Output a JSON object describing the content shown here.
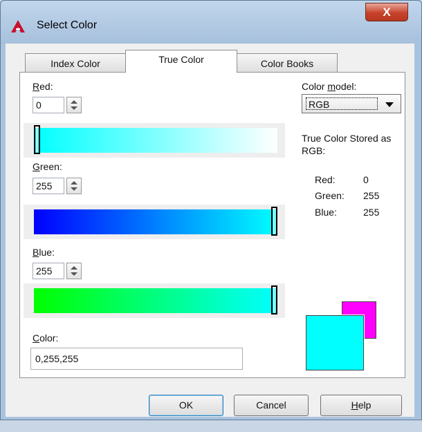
{
  "window": {
    "title": "Select Color",
    "close_glyph": "X"
  },
  "tabs": [
    {
      "label": "Index Color",
      "active": false
    },
    {
      "label": "True Color",
      "active": true
    },
    {
      "label": "Color Books",
      "active": false
    }
  ],
  "red": {
    "label_key": "R",
    "label_rest": "ed:",
    "value": "0",
    "fraction": 0.0
  },
  "green": {
    "label_key": "G",
    "label_rest": "reen:",
    "value": "255",
    "fraction": 1.0
  },
  "blue": {
    "label_key": "B",
    "label_rest": "lue:",
    "value": "255",
    "fraction": 1.0
  },
  "color_model": {
    "label_pre": "Color ",
    "label_key": "m",
    "label_post": "odel:",
    "selected": "RGB"
  },
  "stored": {
    "heading": "True Color Stored as RGB:",
    "rows": [
      {
        "name": "Red:",
        "value": "0"
      },
      {
        "name": "Green:",
        "value": "255"
      },
      {
        "name": "Blue:",
        "value": "255"
      }
    ]
  },
  "color_field": {
    "label_key": "C",
    "label_rest": "olor:",
    "value": "0,255,255"
  },
  "preview": {
    "new_color": "#00ffff",
    "old_color": "#ff00ff"
  },
  "gradients": {
    "red": [
      "#00ffff",
      "#ffffff"
    ],
    "green": [
      "#0000ff",
      "#00ffff"
    ],
    "blue": [
      "#00ff00",
      "#00ffff"
    ]
  },
  "buttons": {
    "ok": "OK",
    "cancel": "Cancel",
    "help_key": "H",
    "help_rest": "elp"
  }
}
